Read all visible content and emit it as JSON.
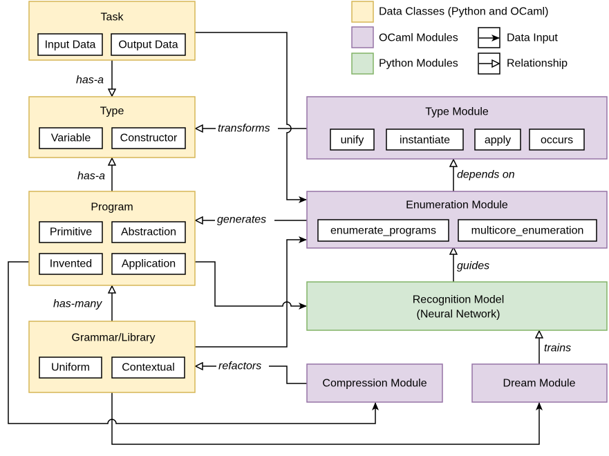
{
  "legend": {
    "data_classes": "Data Classes (Python and OCaml)",
    "ocaml_modules": "OCaml Modules",
    "python_modules": "Python Modules",
    "data_input": "Data Input",
    "relationship": "Relationship"
  },
  "colors": {
    "data_class": "#fff2cc",
    "ocaml_module": "#e1d5e7",
    "python_module": "#d5e8d4"
  },
  "nodes": {
    "task": {
      "title": "Task",
      "items": [
        "Input Data",
        "Output Data"
      ]
    },
    "type": {
      "title": "Type",
      "items": [
        "Variable",
        "Constructor"
      ]
    },
    "program": {
      "title": "Program",
      "items": [
        "Primitive",
        "Abstraction",
        "Invented",
        "Application"
      ]
    },
    "grammar": {
      "title": "Grammar/Library",
      "items": [
        "Uniform",
        "Contextual"
      ]
    },
    "type_module": {
      "title": "Type Module",
      "items": [
        "unify",
        "instantiate",
        "apply",
        "occurs"
      ]
    },
    "enumeration_module": {
      "title": "Enumeration Module",
      "items": [
        "enumerate_programs",
        "multicore_enumeration"
      ]
    },
    "recognition_model": {
      "title": "Recognition Model",
      "subtitle": "(Neural Network)"
    },
    "compression_module": {
      "title": "Compression Module"
    },
    "dream_module": {
      "title": "Dream Module"
    }
  },
  "edges": {
    "task_type": "has-a",
    "type_program": "has-a",
    "program_grammar": "has-many",
    "transforms": "transforms",
    "generates": "generates",
    "depends_on": "depends on",
    "guides": "guides",
    "trains": "trains",
    "refactors": "refactors"
  }
}
